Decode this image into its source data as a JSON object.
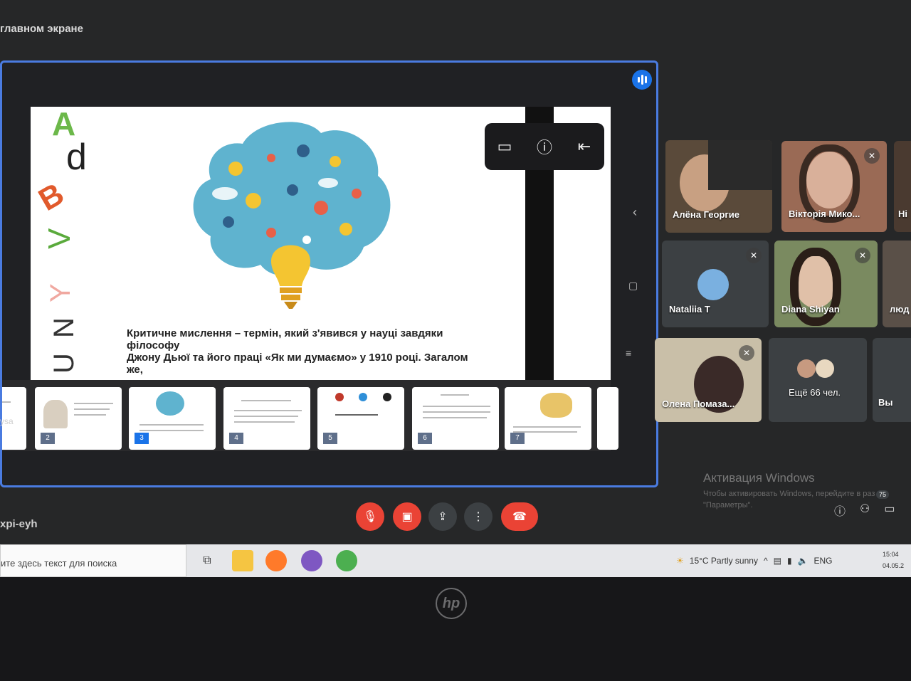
{
  "top_bar": {
    "title": "главном экране"
  },
  "slide": {
    "letters": [
      "A",
      "d",
      "B",
      "V",
      "U"
    ],
    "text_lines": [
      "Критичне мислення – термін, який з'явився у науці завдяки",
      "філософу",
      "Джону Дьюї та його праці «Як ми думаємо» у 1910 році. Загалом",
      "же,"
    ]
  },
  "overlay_toolbar": {
    "icons": [
      "monitor-icon",
      "info-icon",
      "exit-icon"
    ]
  },
  "filmstrip": {
    "thumbnails": [
      {
        "number": "",
        "active": false
      },
      {
        "number": "2",
        "active": false
      },
      {
        "number": "3",
        "active": true
      },
      {
        "number": "4",
        "active": false
      },
      {
        "number": "5",
        "active": false
      },
      {
        "number": "6",
        "active": false
      },
      {
        "number": "7",
        "active": false
      }
    ]
  },
  "presenter_label": "ysa",
  "participants": [
    {
      "name": "Алёна Георгие",
      "muted": false
    },
    {
      "name": "Вікторія Мико...",
      "muted": true
    },
    {
      "name": "Hi",
      "muted": false
    },
    {
      "name": "Nataliia T",
      "muted": true
    },
    {
      "name": "Diana Shiyan",
      "muted": true
    },
    {
      "name": "люд",
      "muted": false
    },
    {
      "name": "Олена Помаза...",
      "muted": true
    },
    {
      "name": "Ещё 66 чел.",
      "muted": false
    },
    {
      "name": "Вы",
      "muted": false
    }
  ],
  "activation": {
    "title": "Активация Windows",
    "line1": "Чтобы активировать Windows, перейдите в раз",
    "line2": "\"Параметры\"."
  },
  "meeting": {
    "code": "xpi-eyh",
    "participant_count": "75",
    "controls": [
      "mic-off",
      "camera-off",
      "present",
      "more",
      "end-call"
    ]
  },
  "taskbar": {
    "search_placeholder": "ите здесь текст для поиска",
    "weather": "15°C  Partly sunny",
    "language": "ENG",
    "time": "15:04",
    "date": "04.05.2"
  },
  "colors": {
    "accent": "#1a73e8",
    "end_call": "#ea4335",
    "panel_border": "#4a7be0"
  }
}
